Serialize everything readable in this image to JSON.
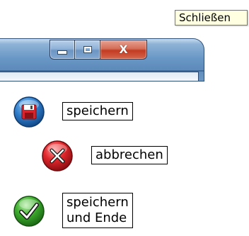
{
  "tooltip": {
    "text": "Schließen"
  },
  "window": {
    "buttons": {
      "minimize_icon": "minimize-icon",
      "maximize_icon": "maximize-icon",
      "close_label": "X"
    },
    "colors": {
      "frame": "#6a98c6",
      "close": "#c23b22"
    }
  },
  "actions": [
    {
      "icon": "floppy-disk-icon",
      "label": "speichern"
    },
    {
      "icon": "cancel-x-icon",
      "label": "abbrechen"
    },
    {
      "icon": "checkmark-icon",
      "label": "speichern\nund Ende"
    }
  ]
}
